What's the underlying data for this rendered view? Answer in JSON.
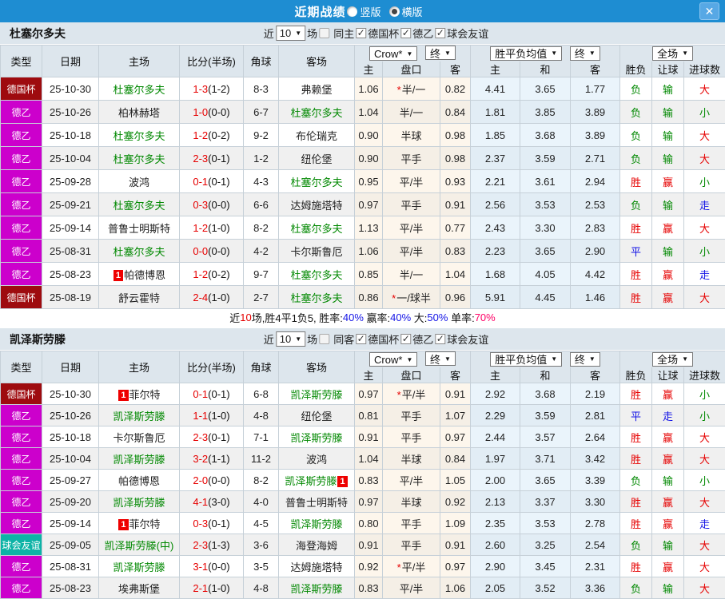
{
  "titlebar": {
    "title": "近期战绩",
    "vertical": "竖版",
    "horizontal": "横版"
  },
  "icons": {
    "check": "✓",
    "caret": "▼",
    "close": "✕"
  },
  "colors": {
    "titlebar_blue": "#1e8dd2",
    "header_bg": "#dde6ed",
    "team_green": "#008800",
    "score_red": "#e60000",
    "crow_col_bg": "#fdf6ec",
    "avg_col_bg": "#eaf4fb"
  },
  "league_styles": {
    "德国杯": "#9e0b0f",
    "德乙": "#cc00cc",
    "球会友谊": "#0db3a6"
  },
  "result_colors": {
    "胜": "#e60000",
    "平": "#1515e6",
    "负": "#008800",
    "赢": "#e60000",
    "走": "#1515e6",
    "输": "#008800",
    "大": "#e60000",
    "小": "#008800"
  },
  "table_header": {
    "type": "类型",
    "date": "日期",
    "home": "主场",
    "score": "比分(半场)",
    "corner": "角球",
    "away": "客场",
    "crow_select": "Crow*",
    "final_select": "终",
    "avg_select": "胜平负均值",
    "full_select": "全场",
    "odds_home": "主",
    "handicap": "盘口",
    "odds_away": "客",
    "avg_home": "主",
    "avg_draw": "和",
    "avg_away": "客",
    "wdl": "胜负",
    "let_ball": "让球",
    "goals": "进球数"
  },
  "sections": [
    {
      "team": "杜塞尔多夫",
      "filter": {
        "near": "近",
        "count": "10",
        "unit": "场",
        "same": "同主",
        "leagues": [
          "德国杯",
          "德乙",
          "球会友谊"
        ]
      },
      "rows": [
        {
          "league": "德国杯",
          "date": "25-10-30",
          "home": {
            "name": "杜塞尔多夫",
            "green": true
          },
          "score": "1-3",
          "half": "(1-2)",
          "corner": "8-3",
          "away": {
            "name": "弗赖堡"
          },
          "o1": "1.06",
          "hc": "半/一",
          "star": true,
          "o2": "0.82",
          "w": "4.41",
          "d": "3.65",
          "l": "1.77",
          "r1": "负",
          "r2": "输",
          "r3": "大"
        },
        {
          "league": "德乙",
          "date": "25-10-26",
          "home": {
            "name": "柏林赫塔"
          },
          "score": "1-0",
          "half": "(0-0)",
          "corner": "6-7",
          "away": {
            "name": "杜塞尔多夫",
            "green": true
          },
          "o1": "1.04",
          "hc": "半/一",
          "o2": "0.84",
          "w": "1.81",
          "d": "3.85",
          "l": "3.89",
          "r1": "负",
          "r2": "输",
          "r3": "小"
        },
        {
          "league": "德乙",
          "date": "25-10-18",
          "home": {
            "name": "杜塞尔多夫",
            "green": true
          },
          "score": "1-2",
          "half": "(0-2)",
          "corner": "9-2",
          "away": {
            "name": "布伦瑞克"
          },
          "o1": "0.90",
          "hc": "半球",
          "o2": "0.98",
          "w": "1.85",
          "d": "3.68",
          "l": "3.89",
          "r1": "负",
          "r2": "输",
          "r3": "大"
        },
        {
          "league": "德乙",
          "date": "25-10-04",
          "home": {
            "name": "杜塞尔多夫",
            "green": true
          },
          "score": "2-3",
          "half": "(0-1)",
          "corner": "1-2",
          "away": {
            "name": "纽伦堡"
          },
          "o1": "0.90",
          "hc": "平手",
          "o2": "0.98",
          "w": "2.37",
          "d": "3.59",
          "l": "2.71",
          "r1": "负",
          "r2": "输",
          "r3": "大"
        },
        {
          "league": "德乙",
          "date": "25-09-28",
          "home": {
            "name": "波鸿"
          },
          "score": "0-1",
          "half": "(0-1)",
          "corner": "4-3",
          "away": {
            "name": "杜塞尔多夫",
            "green": true
          },
          "o1": "0.95",
          "hc": "平/半",
          "o2": "0.93",
          "w": "2.21",
          "d": "3.61",
          "l": "2.94",
          "r1": "胜",
          "r2": "赢",
          "r3": "小"
        },
        {
          "league": "德乙",
          "date": "25-09-21",
          "home": {
            "name": "杜塞尔多夫",
            "green": true
          },
          "score": "0-3",
          "half": "(0-0)",
          "corner": "6-6",
          "away": {
            "name": "达姆施塔特"
          },
          "o1": "0.97",
          "hc": "平手",
          "o2": "0.91",
          "w": "2.56",
          "d": "3.53",
          "l": "2.53",
          "r1": "负",
          "r2": "输",
          "r3": "走"
        },
        {
          "league": "德乙",
          "date": "25-09-14",
          "home": {
            "name": "普鲁士明斯特"
          },
          "score": "1-2",
          "half": "(1-0)",
          "corner": "8-2",
          "away": {
            "name": "杜塞尔多夫",
            "green": true
          },
          "o1": "1.13",
          "hc": "平/半",
          "o2": "0.77",
          "w": "2.43",
          "d": "3.30",
          "l": "2.83",
          "r1": "胜",
          "r2": "赢",
          "r3": "大"
        },
        {
          "league": "德乙",
          "date": "25-08-31",
          "home": {
            "name": "杜塞尔多夫",
            "green": true
          },
          "score": "0-0",
          "half": "(0-0)",
          "corner": "4-2",
          "away": {
            "name": "卡尔斯鲁厄"
          },
          "o1": "1.06",
          "hc": "平/半",
          "o2": "0.83",
          "w": "2.23",
          "d": "3.65",
          "l": "2.90",
          "r1": "平",
          "r2": "输",
          "r3": "小"
        },
        {
          "league": "德乙",
          "date": "25-08-23",
          "home": {
            "name": "帕德博恩",
            "badge": "1",
            "badge_pos": "before"
          },
          "score": "1-2",
          "half": "(0-2)",
          "corner": "9-7",
          "away": {
            "name": "杜塞尔多夫",
            "green": true
          },
          "o1": "0.85",
          "hc": "半/一",
          "o2": "1.04",
          "w": "1.68",
          "d": "4.05",
          "l": "4.42",
          "r1": "胜",
          "r2": "赢",
          "r3": "走"
        },
        {
          "league": "德国杯",
          "date": "25-08-19",
          "home": {
            "name": "舒云霍特"
          },
          "score": "2-4",
          "half": "(1-0)",
          "corner": "2-7",
          "away": {
            "name": "杜塞尔多夫",
            "green": true
          },
          "o1": "0.86",
          "hc": "一/球半",
          "star": true,
          "o2": "0.96",
          "w": "5.91",
          "d": "4.45",
          "l": "1.46",
          "r1": "胜",
          "r2": "赢",
          "r3": "大"
        }
      ],
      "summary": [
        {
          "t": "近",
          "c": "#111111"
        },
        {
          "t": "10",
          "c": "#e60000"
        },
        {
          "t": "场,胜4平1负5, 胜率:",
          "c": "#111111"
        },
        {
          "t": "40%",
          "c": "#1515e6"
        },
        {
          "t": " 赢率:",
          "c": "#111111"
        },
        {
          "t": "40%",
          "c": "#1515e6"
        },
        {
          "t": " 大:",
          "c": "#111111"
        },
        {
          "t": "50%",
          "c": "#1515e6"
        },
        {
          "t": " 单率:",
          "c": "#111111"
        },
        {
          "t": "70%",
          "c": "#ff0066"
        }
      ]
    },
    {
      "team": "凯泽斯劳滕",
      "filter": {
        "near": "近",
        "count": "10",
        "unit": "场",
        "same": "同客",
        "leagues": [
          "德国杯",
          "德乙",
          "球会友谊"
        ]
      },
      "rows": [
        {
          "league": "德国杯",
          "date": "25-10-30",
          "home": {
            "name": "菲尔特",
            "badge": "1",
            "badge_pos": "before"
          },
          "score": "0-1",
          "half": "(0-1)",
          "corner": "6-8",
          "away": {
            "name": "凯泽斯劳滕",
            "green": true
          },
          "o1": "0.97",
          "hc": "平/半",
          "star": true,
          "o2": "0.91",
          "w": "2.92",
          "d": "3.68",
          "l": "2.19",
          "r1": "胜",
          "r2": "赢",
          "r3": "小"
        },
        {
          "league": "德乙",
          "date": "25-10-26",
          "home": {
            "name": "凯泽斯劳滕",
            "green": true
          },
          "score": "1-1",
          "half": "(1-0)",
          "corner": "4-8",
          "away": {
            "name": "纽伦堡"
          },
          "o1": "0.81",
          "hc": "平手",
          "o2": "1.07",
          "w": "2.29",
          "d": "3.59",
          "l": "2.81",
          "r1": "平",
          "r2": "走",
          "r3": "小"
        },
        {
          "league": "德乙",
          "date": "25-10-18",
          "home": {
            "name": "卡尔斯鲁厄"
          },
          "score": "2-3",
          "half": "(0-1)",
          "corner": "7-1",
          "away": {
            "name": "凯泽斯劳滕",
            "green": true
          },
          "o1": "0.91",
          "hc": "平手",
          "o2": "0.97",
          "w": "2.44",
          "d": "3.57",
          "l": "2.64",
          "r1": "胜",
          "r2": "赢",
          "r3": "大"
        },
        {
          "league": "德乙",
          "date": "25-10-04",
          "home": {
            "name": "凯泽斯劳滕",
            "green": true
          },
          "score": "3-2",
          "half": "(1-1)",
          "corner": "11-2",
          "away": {
            "name": "波鸿"
          },
          "o1": "1.04",
          "hc": "半球",
          "o2": "0.84",
          "w": "1.97",
          "d": "3.71",
          "l": "3.42",
          "r1": "胜",
          "r2": "赢",
          "r3": "大"
        },
        {
          "league": "德乙",
          "date": "25-09-27",
          "home": {
            "name": "帕德博恩"
          },
          "score": "2-0",
          "half": "(0-0)",
          "corner": "8-2",
          "away": {
            "name": "凯泽斯劳滕",
            "green": true,
            "badge": "1",
            "badge_pos": "after"
          },
          "o1": "0.83",
          "hc": "平/半",
          "o2": "1.05",
          "w": "2.00",
          "d": "3.65",
          "l": "3.39",
          "r1": "负",
          "r2": "输",
          "r3": "小"
        },
        {
          "league": "德乙",
          "date": "25-09-20",
          "home": {
            "name": "凯泽斯劳滕",
            "green": true
          },
          "score": "4-1",
          "half": "(3-0)",
          "corner": "4-0",
          "away": {
            "name": "普鲁士明斯特"
          },
          "o1": "0.97",
          "hc": "半球",
          "o2": "0.92",
          "w": "2.13",
          "d": "3.37",
          "l": "3.30",
          "r1": "胜",
          "r2": "赢",
          "r3": "大"
        },
        {
          "league": "德乙",
          "date": "25-09-14",
          "home": {
            "name": "菲尔特",
            "badge": "1",
            "badge_pos": "before"
          },
          "score": "0-3",
          "half": "(0-1)",
          "corner": "4-5",
          "away": {
            "name": "凯泽斯劳滕",
            "green": true
          },
          "o1": "0.80",
          "hc": "平手",
          "o2": "1.09",
          "w": "2.35",
          "d": "3.53",
          "l": "2.78",
          "r1": "胜",
          "r2": "赢",
          "r3": "走"
        },
        {
          "league": "球会友谊",
          "date": "25-09-05",
          "home": {
            "name": "凯泽斯劳滕(中)",
            "green": true
          },
          "score": "2-3",
          "half": "(1-3)",
          "corner": "3-6",
          "away": {
            "name": "海登海姆"
          },
          "o1": "0.91",
          "hc": "平手",
          "o2": "0.91",
          "w": "2.60",
          "d": "3.25",
          "l": "2.54",
          "r1": "负",
          "r2": "输",
          "r3": "大"
        },
        {
          "league": "德乙",
          "date": "25-08-31",
          "home": {
            "name": "凯泽斯劳滕",
            "green": true
          },
          "score": "3-1",
          "half": "(0-0)",
          "corner": "3-5",
          "away": {
            "name": "达姆施塔特"
          },
          "o1": "0.92",
          "hc": "平/半",
          "star": true,
          "o2": "0.97",
          "w": "2.90",
          "d": "3.45",
          "l": "2.31",
          "r1": "胜",
          "r2": "赢",
          "r3": "大"
        },
        {
          "league": "德乙",
          "date": "25-08-23",
          "home": {
            "name": "埃弗斯堡"
          },
          "score": "2-1",
          "half": "(1-0)",
          "corner": "4-8",
          "away": {
            "name": "凯泽斯劳滕",
            "green": true
          },
          "o1": "0.83",
          "hc": "平/半",
          "o2": "1.06",
          "w": "2.05",
          "d": "3.52",
          "l": "3.36",
          "r1": "负",
          "r2": "输",
          "r3": "大"
        }
      ]
    }
  ]
}
